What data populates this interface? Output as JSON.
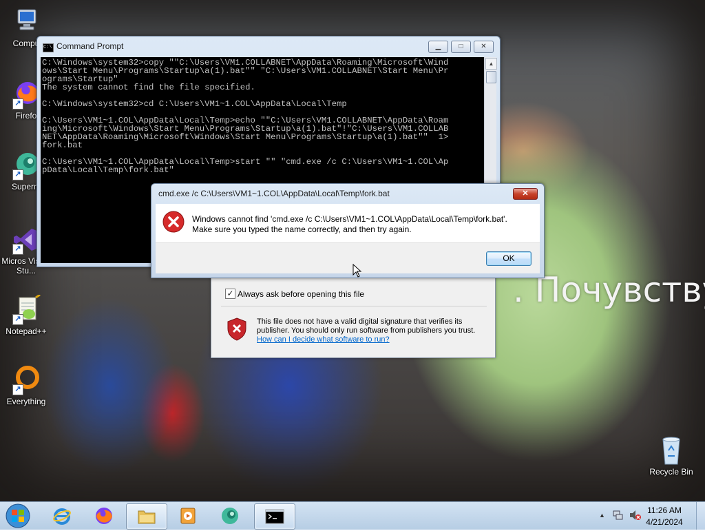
{
  "desktop": {
    "overlay_text": ". Почувству",
    "icons": [
      {
        "name": "computer-icon",
        "label": "Compu"
      },
      {
        "name": "firefox-icon",
        "label": "Firefo"
      },
      {
        "name": "supermium-icon",
        "label": "Superm"
      },
      {
        "name": "visual-studio-icon",
        "label": "Micros Visual Stu..."
      },
      {
        "name": "notepad-plus-plus-icon",
        "label": "Notepad++"
      },
      {
        "name": "everything-icon",
        "label": "Everything"
      },
      {
        "name": "recycle-bin-icon",
        "label": "Recycle Bin"
      }
    ]
  },
  "cmd": {
    "title": "Command Prompt",
    "lines": [
      "C:\\Windows\\system32>copy \"\"C:\\Users\\VM1.COLLABNET\\AppData\\Roaming\\Microsoft\\Wind",
      "ows\\Start Menu\\Programs\\Startup\\a(1).bat\"\" \"C:\\Users\\VM1.COLLABNET\\Start Menu\\Pr",
      "ograms\\Startup\"",
      "The system cannot find the file specified.",
      "",
      "C:\\Windows\\system32>cd C:\\Users\\VM1~1.COL\\AppData\\Local\\Temp",
      "",
      "C:\\Users\\VM1~1.COL\\AppData\\Local\\Temp>echo \"\"C:\\Users\\VM1.COLLABNET\\AppData\\Roam",
      "ing\\Microsoft\\Windows\\Start Menu\\Programs\\Startup\\a(1).bat\"!\"C:\\Users\\VM1.COLLAB",
      "NET\\AppData\\Roaming\\Microsoft\\Windows\\Start Menu\\Programs\\Startup\\a(1).bat\"\"  1>",
      "fork.bat",
      "",
      "C:\\Users\\VM1~1.COL\\AppData\\Local\\Temp>start \"\" \"cmd.exe /c C:\\Users\\VM1~1.COL\\Ap",
      "pData\\Local\\Temp\\fork.bat\""
    ]
  },
  "security_dialog": {
    "checkbox_label": "Always ask before opening this file",
    "checkbox_checked": true,
    "warning_text_1": "This file does not have a valid digital signature that verifies its",
    "warning_text_2": "publisher.  You should only run software from publishers you trust.",
    "link_text": "How can I decide what software to run?"
  },
  "error_dialog": {
    "title": "cmd.exe /c C:\\Users\\VM1~1.COL\\AppData\\Local\\Temp\\fork.bat",
    "message_1": "Windows cannot find 'cmd.exe /c C:\\Users\\VM1~1.COL\\AppData\\Local\\Temp\\fork.bat'.",
    "message_2": "Make sure you typed the name correctly, and then try again.",
    "ok_label": "OK"
  },
  "taskbar": {
    "clock_time": "11:26 AM",
    "clock_date": "4/21/2024",
    "apps": [
      "start-button",
      "internet-explorer-icon",
      "firefox-icon",
      "file-explorer-icon",
      "media-player-icon",
      "supermium-icon",
      "command-prompt-icon"
    ],
    "active_app": "command-prompt-icon"
  }
}
